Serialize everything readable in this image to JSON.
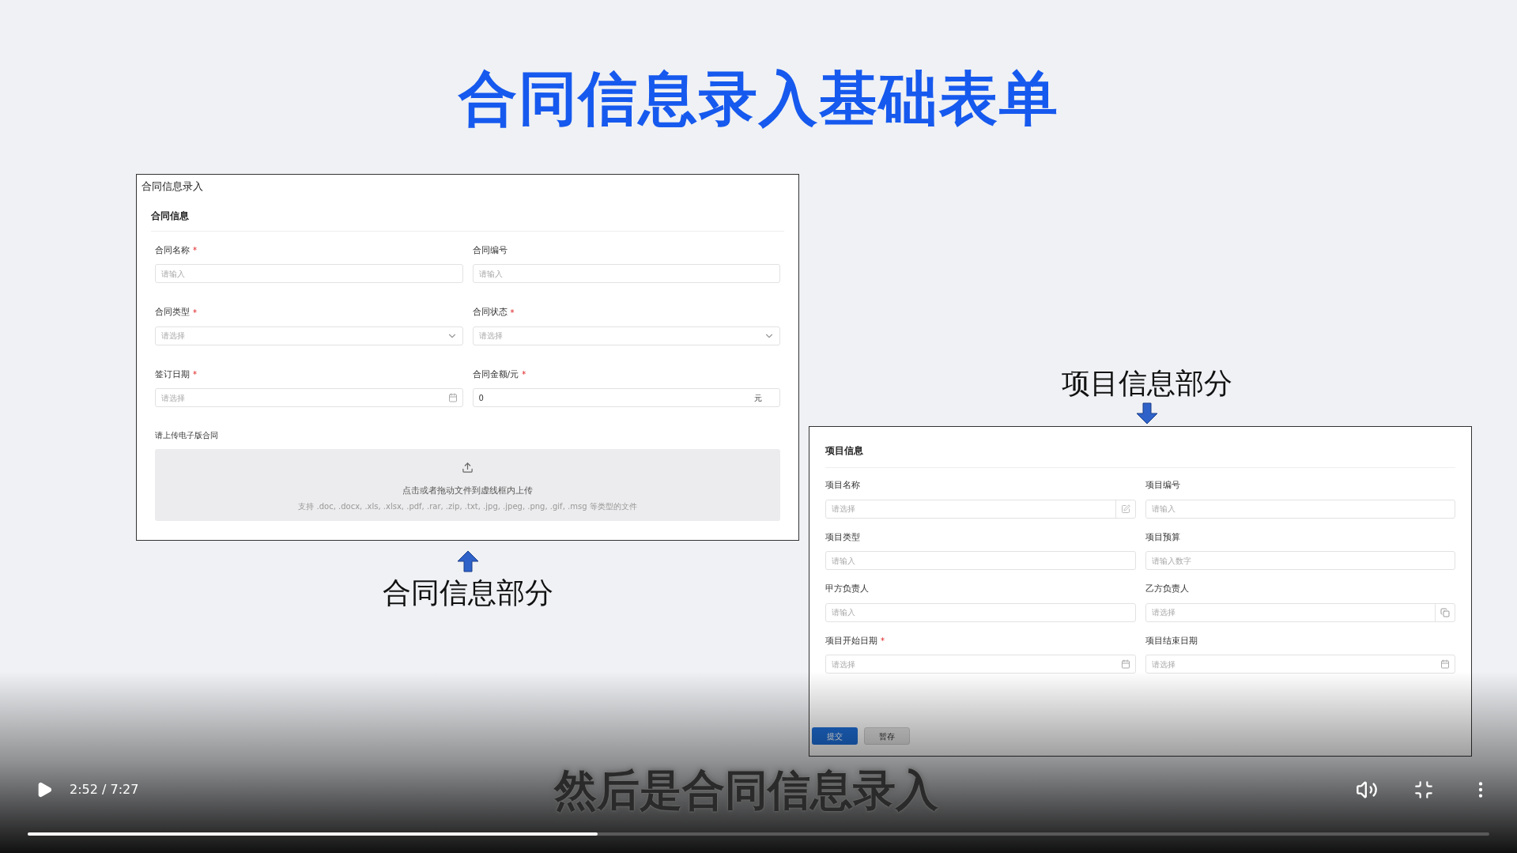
{
  "slide": {
    "title": "合同信息录入基础表单",
    "contract_form": {
      "window_title": "合同信息录入",
      "section_title": "合同信息",
      "fields": [
        {
          "label": "合同名称",
          "required_mark": "*",
          "kind": "text",
          "placeholder": "请输入"
        },
        {
          "label": "合同编号",
          "kind": "text",
          "placeholder": "请输入"
        },
        {
          "label": "合同类型",
          "required_mark": "*",
          "kind": "select",
          "placeholder": "请选择"
        },
        {
          "label": "合同状态",
          "required_mark": "*",
          "kind": "select",
          "placeholder": "请选择"
        },
        {
          "label": "签订日期",
          "required_mark": "*",
          "kind": "date",
          "placeholder": "请选择"
        },
        {
          "label": "合同金额/元",
          "required_mark": "*",
          "kind": "amount",
          "value": "0",
          "suffix": "元"
        }
      ],
      "upload": {
        "label": "请上传电子版合同",
        "hint": "点击或者拖动文件到虚线框内上传",
        "formats": "支持 .doc, .docx, .xls, .xlsx, .pdf, .rar, .zip, .txt, .jpg, .jpeg, .png, .gif, .msg 等类型的文件"
      }
    },
    "contract_caption": "合同信息部分",
    "project_caption": "项目信息部分",
    "project_form": {
      "section_title": "项目信息",
      "fields": [
        {
          "label": "项目名称",
          "kind": "picker",
          "placeholder": "请选择"
        },
        {
          "label": "项目编号",
          "kind": "text",
          "placeholder": "请输入"
        },
        {
          "label": "项目类型",
          "kind": "text",
          "placeholder": "请输入"
        },
        {
          "label": "项目预算",
          "kind": "text",
          "placeholder": "请输入数字"
        },
        {
          "label": "甲方负责人",
          "kind": "text",
          "placeholder": "请输入"
        },
        {
          "label": "乙方负责人",
          "kind": "copy",
          "placeholder": "请选择"
        },
        {
          "label": "项目开始日期",
          "required_mark": "*",
          "kind": "date",
          "placeholder": "请选择"
        },
        {
          "label": "项目结束日期",
          "kind": "date",
          "placeholder": "请选择"
        }
      ],
      "buttons": [
        {
          "label": "提交",
          "kind": "primary"
        },
        {
          "label": "暂存",
          "kind": "secondary"
        }
      ]
    }
  },
  "player": {
    "subtitle": "然后是合同信息录入",
    "time": "2:52 / 7:27",
    "progress": {
      "level": 0.39
    }
  }
}
